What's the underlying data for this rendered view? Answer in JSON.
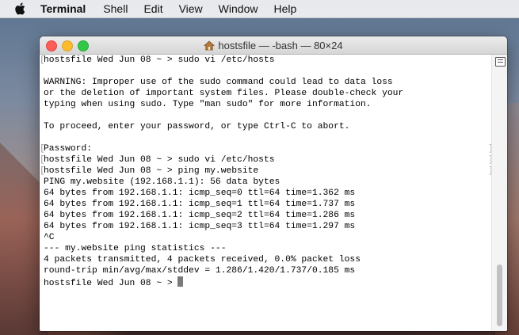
{
  "menubar": {
    "apple_icon": "apple-logo-icon",
    "app_name": "Terminal",
    "items": [
      "Shell",
      "Edit",
      "View",
      "Window",
      "Help"
    ]
  },
  "window": {
    "title": "hostsfile — -bash — 80×24",
    "title_icon": "home-icon"
  },
  "terminal": {
    "lines": [
      "hostsfile Wed Jun 08 ~ > sudo vi /etc/hosts",
      "",
      "WARNING: Improper use of the sudo command could lead to data loss",
      "or the deletion of important system files. Please double-check your",
      "typing when using sudo. Type \"man sudo\" for more information.",
      "",
      "To proceed, enter your password, or type Ctrl-C to abort.",
      "",
      "Password:",
      "hostsfile Wed Jun 08 ~ > sudo vi /etc/hosts",
      "hostsfile Wed Jun 08 ~ > ping my.website",
      "PING my.website (192.168.1.1): 56 data bytes",
      "64 bytes from 192.168.1.1: icmp_seq=0 ttl=64 time=1.362 ms",
      "64 bytes from 192.168.1.1: icmp_seq=1 ttl=64 time=1.737 ms",
      "64 bytes from 192.168.1.1: icmp_seq=2 ttl=64 time=1.286 ms",
      "64 bytes from 192.168.1.1: icmp_seq=3 ttl=64 time=1.297 ms",
      "^C",
      "--- my.website ping statistics ---",
      "4 packets transmitted, 4 packets received, 0.0% packet loss",
      "round-trip min/avg/max/stddev = 1.286/1.420/1.737/0.185 ms",
      "hostsfile Wed Jun 08 ~ > "
    ],
    "left_bracket": "[",
    "right_bracket": "]"
  },
  "colors": {
    "close": "#fc5f57",
    "minimize": "#fdbc2e",
    "zoom": "#33c748"
  }
}
